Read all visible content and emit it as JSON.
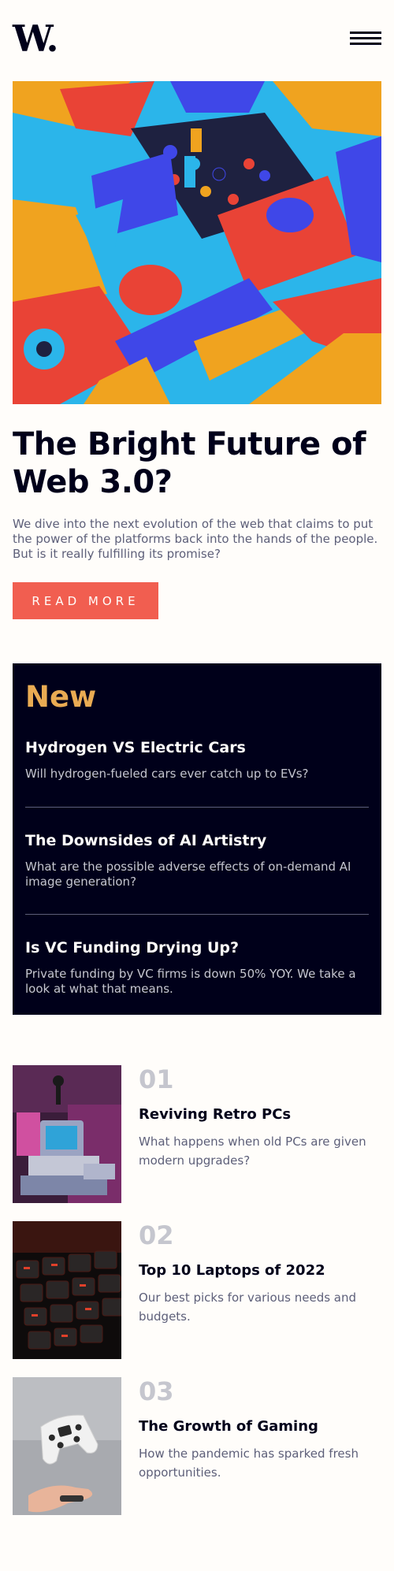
{
  "header": {
    "logo": "W.",
    "menu_icon": "hamburger-menu-icon"
  },
  "hero": {
    "image_icon": "abstract-3d-shapes-image",
    "title": "The Bright Future of Web 3.0?",
    "description": "We dive into the next evolution of the web that claims to put the power of the platforms back into the hands of the people. But is it really fulfilling its promise?",
    "cta_label": "READ MORE"
  },
  "new_section": {
    "heading": "New",
    "items": [
      {
        "title": "Hydrogen VS Electric Cars",
        "description": "Will hydrogen-fueled cars ever catch up to EVs?"
      },
      {
        "title": "The Downsides of AI Artistry",
        "description": "What are the possible adverse effects of on-demand AI image generation?"
      },
      {
        "title": "Is VC Funding Drying Up?",
        "description": "Private funding by VC firms is down 50% YOY. We take a look at what that means."
      }
    ]
  },
  "articles": [
    {
      "number": "01",
      "title": "Reviving Retro PCs",
      "description": "What happens when old PCs are given modern upgrades?",
      "image": "retro-pc-image"
    },
    {
      "number": "02",
      "title": "Top 10 Laptops of 2022",
      "description": "Our best picks for various needs and budgets.",
      "image": "laptop-keyboard-image"
    },
    {
      "number": "03",
      "title": "The Growth of Gaming",
      "description": "How the pandemic has sparked fresh opportunities.",
      "image": "game-controller-image"
    }
  ],
  "colors": {
    "background": "#fffdfa",
    "dark": "#00001a",
    "accent_red": "#f15e50",
    "accent_orange": "#e9ab53",
    "grayish_blue": "#5d5f79",
    "light_gray": "#c5c6ce"
  }
}
